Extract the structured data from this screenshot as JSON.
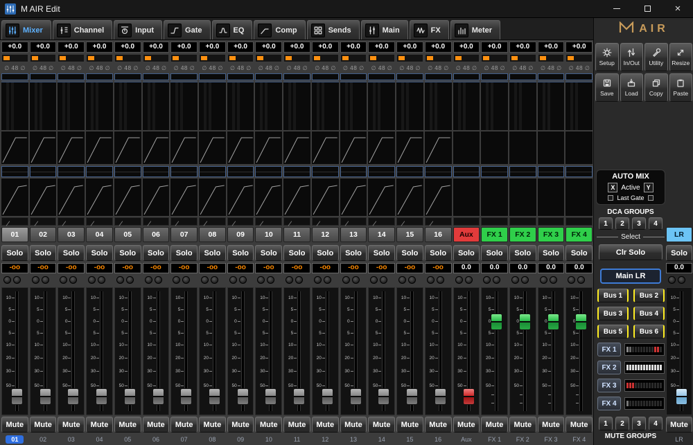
{
  "window": {
    "title": "M AIR Edit"
  },
  "tabs": [
    {
      "label": "Mixer",
      "icon": "mixer-icon",
      "active": true
    },
    {
      "label": "Channel",
      "icon": "channel-icon",
      "active": false
    },
    {
      "label": "Input",
      "icon": "input-icon",
      "active": false
    },
    {
      "label": "Gate",
      "icon": "gate-icon",
      "active": false
    },
    {
      "label": "EQ",
      "icon": "eq-icon",
      "active": false
    },
    {
      "label": "Comp",
      "icon": "comp-icon",
      "active": false
    },
    {
      "label": "Sends",
      "icon": "sends-icon",
      "active": false
    },
    {
      "label": "Main",
      "icon": "main-icon",
      "active": false
    },
    {
      "label": "FX",
      "icon": "fx-icon",
      "active": false
    },
    {
      "label": "Meter",
      "icon": "meter-icon",
      "active": false
    }
  ],
  "strip_common": {
    "gain": "+0.0",
    "indicators": [
      "∅",
      "48",
      "∅"
    ],
    "solo_label": "Solo",
    "mute_label": "Mute",
    "fader_scale": [
      "10",
      "5",
      "0",
      "5",
      "10",
      "20",
      "30",
      "50"
    ]
  },
  "strips": [
    {
      "num": "01",
      "name": "01",
      "value": "-oo",
      "type": "channel",
      "selected": true
    },
    {
      "num": "02",
      "name": "02",
      "value": "-oo",
      "type": "channel",
      "selected": false
    },
    {
      "num": "03",
      "name": "03",
      "value": "-oo",
      "type": "channel",
      "selected": false
    },
    {
      "num": "04",
      "name": "04",
      "value": "-oo",
      "type": "channel",
      "selected": false
    },
    {
      "num": "05",
      "name": "05",
      "value": "-oo",
      "type": "channel",
      "selected": false
    },
    {
      "num": "06",
      "name": "06",
      "value": "-oo",
      "type": "channel",
      "selected": false
    },
    {
      "num": "07",
      "name": "07",
      "value": "-oo",
      "type": "channel",
      "selected": false
    },
    {
      "num": "08",
      "name": "08",
      "value": "-oo",
      "type": "channel",
      "selected": false
    },
    {
      "num": "09",
      "name": "09",
      "value": "-oo",
      "type": "channel",
      "selected": false
    },
    {
      "num": "10",
      "name": "10",
      "value": "-oo",
      "type": "channel",
      "selected": false
    },
    {
      "num": "11",
      "name": "11",
      "value": "-oo",
      "type": "channel",
      "selected": false
    },
    {
      "num": "12",
      "name": "12",
      "value": "-oo",
      "type": "channel",
      "selected": false
    },
    {
      "num": "13",
      "name": "13",
      "value": "-oo",
      "type": "channel",
      "selected": false
    },
    {
      "num": "14",
      "name": "14",
      "value": "-oo",
      "type": "channel",
      "selected": false
    },
    {
      "num": "15",
      "name": "15",
      "value": "-oo",
      "type": "channel",
      "selected": false
    },
    {
      "num": "16",
      "name": "16",
      "value": "-oo",
      "type": "channel",
      "selected": false
    },
    {
      "num": "Aux",
      "name": "Aux",
      "value": "0.0",
      "type": "aux",
      "selected": false
    },
    {
      "num": "FX 1",
      "name": "FX 1",
      "value": "0.0",
      "type": "fx",
      "selected": false
    },
    {
      "num": "FX 2",
      "name": "FX 2",
      "value": "0.0",
      "type": "fx",
      "selected": false
    },
    {
      "num": "FX 3",
      "name": "FX 3",
      "value": "0.0",
      "type": "fx",
      "selected": false
    },
    {
      "num": "FX 4",
      "name": "FX 4",
      "value": "0.0",
      "type": "fx",
      "selected": false
    }
  ],
  "lr_strip": {
    "num": "LR",
    "name": "LR",
    "value": "0.0",
    "type": "lr",
    "selected": false
  },
  "right_panel": {
    "logo_text": "AIR",
    "tool_buttons": [
      {
        "label": "Setup",
        "icon": "gear-icon"
      },
      {
        "label": "In/Out",
        "icon": "inout-icon"
      },
      {
        "label": "Utility",
        "icon": "wrench-icon"
      },
      {
        "label": "Resize",
        "icon": "resize-icon"
      }
    ],
    "file_buttons": [
      {
        "label": "Save",
        "icon": "save-icon"
      },
      {
        "label": "Load",
        "icon": "load-icon"
      },
      {
        "label": "Copy",
        "icon": "copy-icon"
      },
      {
        "label": "Paste",
        "icon": "paste-icon"
      }
    ],
    "automix": {
      "title": "AUTO MIX",
      "x_label": "X",
      "active_label": "Active",
      "y_label": "Y",
      "last_gate_label": "Last Gate"
    },
    "dca": {
      "title": "DCA GROUPS",
      "buttons": [
        "1",
        "2",
        "3",
        "4"
      ]
    },
    "select_label": "Select",
    "clr_solo_label": "Clr Solo",
    "main_lr_label": "Main LR",
    "bus_buttons": [
      "Bus 1",
      "Bus 2",
      "Bus 3",
      "Bus 4",
      "Bus 5",
      "Bus 6"
    ],
    "fx_slots": [
      {
        "label": "FX 1",
        "meter": "dim-red-right"
      },
      {
        "label": "FX 2",
        "meter": "white-row"
      },
      {
        "label": "FX 3",
        "meter": "red-left"
      },
      {
        "label": "FX 4",
        "meter": "dim"
      }
    ],
    "mute_groups": {
      "title": "MUTE GROUPS",
      "buttons": [
        "1",
        "2",
        "3",
        "4"
      ]
    }
  },
  "colors": {
    "accent_blue": "#5fb2ff",
    "aux_red": "#e23b3b",
    "fx_green": "#2fcf4a",
    "lr_blue": "#6cc4f5",
    "value_orange": "#ff8a00",
    "pan_orange": "#ff9010",
    "bus_yellow": "#ffee22",
    "logo_gold": "#c89b5a"
  }
}
